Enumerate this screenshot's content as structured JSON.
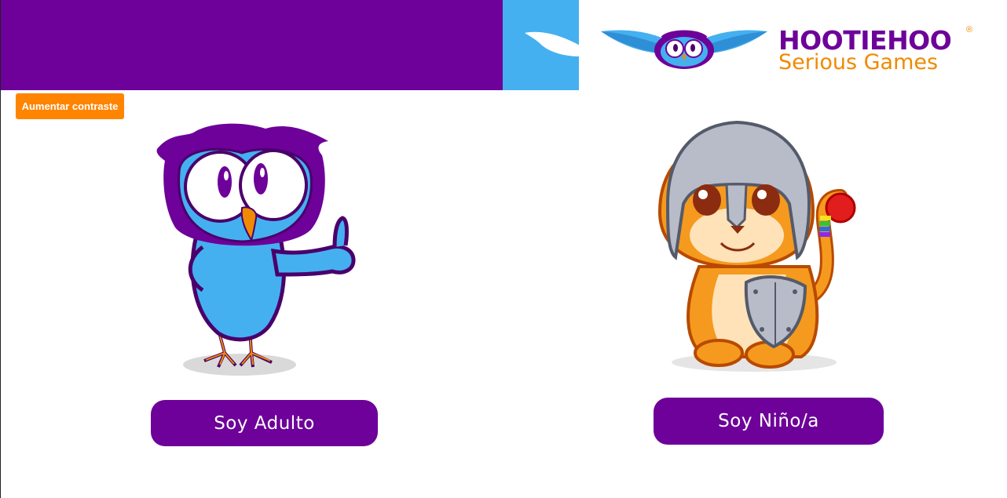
{
  "header": {
    "logo": {
      "name_part1": "HOOTIE",
      "name_part2": "HOO",
      "registered": "®",
      "tagline": "Serious Games"
    },
    "colors": {
      "purple": "#6d0199",
      "blue": "#45b0f0",
      "orange": "#f08a00"
    }
  },
  "accessibility": {
    "contrast_label": "Aumentar contraste"
  },
  "choices": {
    "adult_label": "Soy Adulto",
    "child_label": "Soy Niño/a"
  },
  "icons": [
    "wing-icon",
    "owl-logo-icon",
    "owl-mascot-illustration",
    "tiger-knight-mascot-illustration"
  ]
}
